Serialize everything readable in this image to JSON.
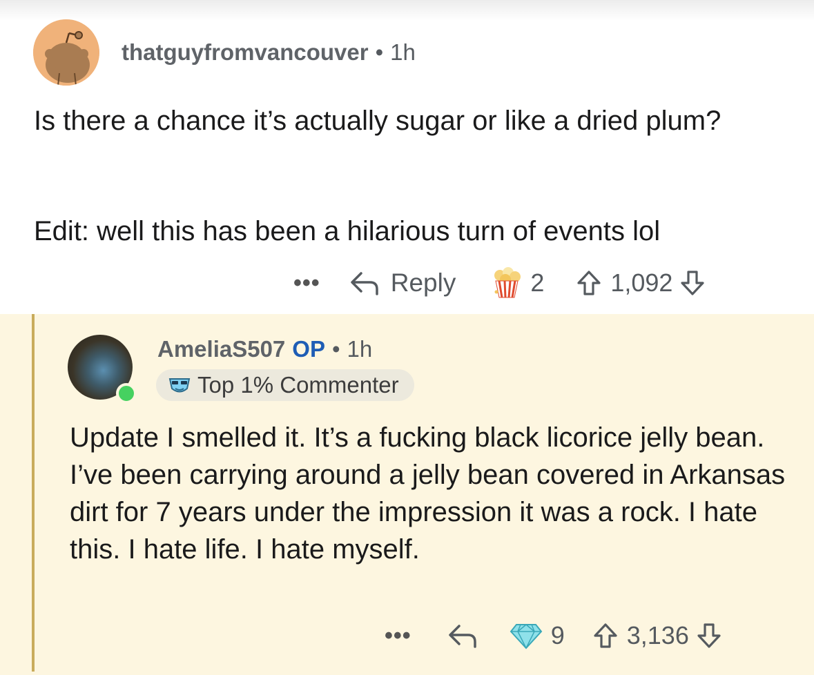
{
  "comment1": {
    "username": "thatguyfromvancouver",
    "separator": "•",
    "time": "1h",
    "body_line1": "Is there a chance it’s actually sugar or like a dried plum?",
    "body_edit": "Edit: well this has been a hilarious turn of events lol",
    "more_label": "•••",
    "reply_label": "Reply",
    "award_count": "2",
    "vote_count": "1,092",
    "avatar_icon": "snoo-avatar-icon",
    "award_icon": "popcorn-award-icon"
  },
  "comment2": {
    "username": "AmeliaS507",
    "op_badge": "OP",
    "separator": "•",
    "time": "1h",
    "flair": "Top 1% Commenter",
    "body": "Update I smelled it. It’s a fucking black licorice jelly bean. I’ve been carrying around a jelly bean covered in Arkansas dirt for 7 years under the impression it was a rock. I hate this. I hate life. I hate myself.",
    "more_label": "•••",
    "award_count": "9",
    "vote_count": "3,136",
    "award_icon": "diamond-award-icon"
  },
  "colors": {
    "reply_background": "#fdf6e0",
    "thread_line": "#c9ac5c",
    "op_blue": "#1e5db5",
    "online_green": "#46d160"
  }
}
